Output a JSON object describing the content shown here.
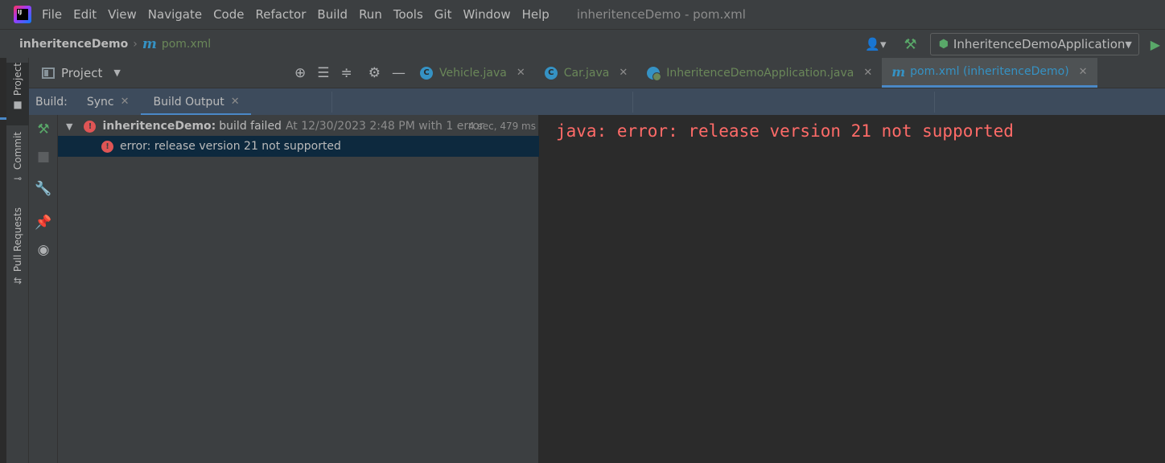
{
  "menubar": {
    "items": [
      "File",
      "Edit",
      "View",
      "Navigate",
      "Code",
      "Refactor",
      "Build",
      "Run",
      "Tools",
      "Git",
      "Window",
      "Help"
    ],
    "window_title": "inheritenceDemo - pom.xml"
  },
  "navbar": {
    "project": "inheritenceDemo",
    "file": "pom.xml",
    "run_config": "InheritenceDemoApplication"
  },
  "side_tabs": [
    "Project",
    "Commit",
    "Pull Requests"
  ],
  "project_panel": {
    "title": "Project"
  },
  "editor_tabs": [
    {
      "label": "Vehicle.java",
      "icon": "class-icon",
      "active": false
    },
    {
      "label": "Car.java",
      "icon": "class-icon",
      "active": false
    },
    {
      "label": "InheritenceDemoApplication.java",
      "icon": "spring-boot-icon",
      "active": false
    },
    {
      "label": "pom.xml (inheritenceDemo)",
      "icon": "maven-icon",
      "active": true
    }
  ],
  "build": {
    "title": "Build:",
    "tabs": [
      {
        "label": "Sync",
        "active": false
      },
      {
        "label": "Build Output",
        "active": true
      }
    ],
    "tree": {
      "project": "inheritenceDemo:",
      "status": "build failed",
      "timestamp": "At 12/30/2023 2:48 PM with 1 error",
      "duration": "4 sec, 479 ms",
      "error": "error: release version 21 not supported"
    },
    "console": "java: error: release version 21 not supported"
  },
  "colors": {
    "error_red": "#ff6b68",
    "accent_blue": "#4a88c7",
    "file_green": "#6a8759"
  }
}
